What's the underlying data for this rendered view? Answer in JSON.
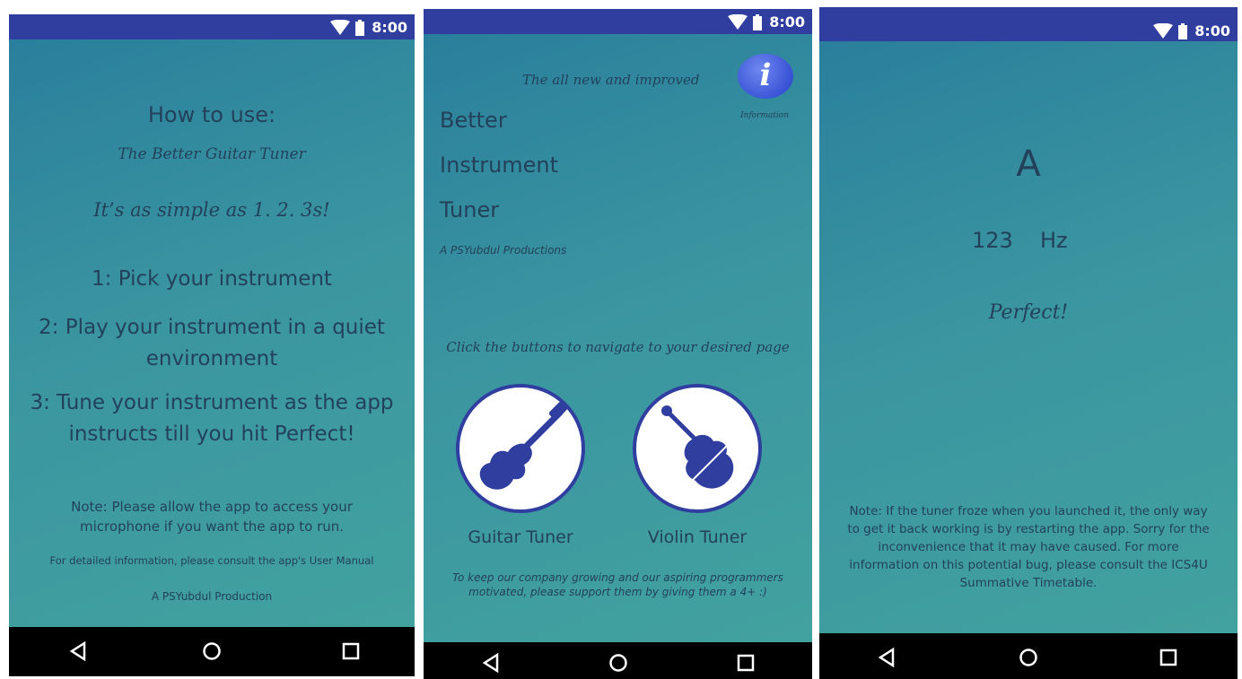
{
  "status_bar": {
    "time": "8:00"
  },
  "screen1": {
    "title": "How to use:",
    "subtitle": "The Better Guitar Tuner",
    "tagline": "It’s as simple as 1. 2. 3s!",
    "steps": [
      "1: Pick your instrument",
      "2: Play your instrument in a quiet environment",
      "3: Tune your instrument as the app instructs till you hit Perfect!"
    ],
    "note": "Note: Please allow the app to access your microphone if you want the app to run.",
    "manual": "For detailed information, please consult the app's User Manual",
    "credit": "A PSYubdul Production"
  },
  "screen2": {
    "tagline": "The all new and improved",
    "info_icon_label": "i",
    "info_label": "Information",
    "title_lines": [
      "Better",
      "Instrument",
      "Tuner"
    ],
    "producer": "A PSYubdul Productions",
    "instruction": "Click the buttons to navigate to your desired page",
    "guitar_label": "Guitar Tuner",
    "violin_label": "Violin Tuner",
    "footer": "To keep our company growing and our aspiring programmers motivated, please support them by giving them a 4+ :)"
  },
  "screen3": {
    "note_name": "A",
    "frequency": "123",
    "unit": "Hz",
    "status": "Perfect!",
    "note": "Note: If the tuner froze when you launched it, the only way to get it back working is by restarting the app. Sorry for the inconvenience that it may have caused. For more information on this potential bug, please consult the ICS4U Summative Timetable."
  },
  "colors": {
    "status_bar": "#303f9f",
    "accent_blue": "#303f9f",
    "text": "#23415b"
  },
  "icons": [
    "wifi-icon",
    "battery-icon",
    "back-icon",
    "home-icon",
    "recents-icon",
    "info-icon",
    "guitar-icon",
    "violin-icon"
  ]
}
